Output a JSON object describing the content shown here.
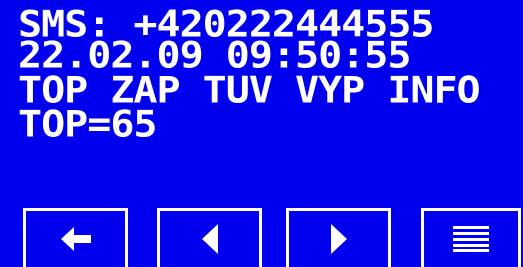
{
  "display": {
    "background_color": "#0000ee",
    "text_color": "#ffffff",
    "lines": [
      "SMS: +420222444555",
      "22.02.09 09:50:55",
      "TOP ZAP TUV VYP INFO",
      "TOP=65"
    ]
  },
  "softkeys": [
    {
      "id": "back",
      "icon": "arrow-left-icon"
    },
    {
      "id": "previous",
      "icon": "triangle-left-icon"
    },
    {
      "id": "next",
      "icon": "triangle-right-icon"
    },
    {
      "id": "menu",
      "icon": "menu-lines-icon"
    }
  ]
}
